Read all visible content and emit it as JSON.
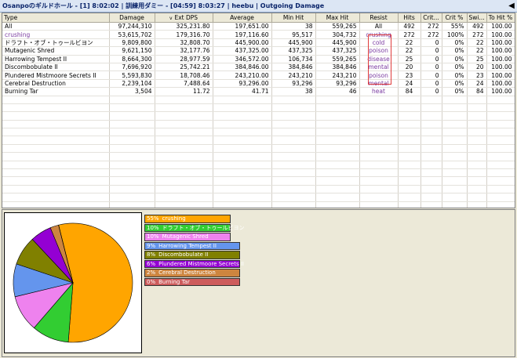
{
  "window": {
    "title": "Osanpoのギルドホール - [1] 8:02:02 | 訓練用ダミー - [04:59] 8:03:27 | heebu | Outgoing Damage",
    "nav_icon": "left-arrow-icon"
  },
  "table": {
    "sort_indicator": "v",
    "headers": [
      "Type",
      "Damage",
      "Ext DPS",
      "Average",
      "Min Hit",
      "Max Hit",
      "Resist",
      "Hits",
      "Crit...",
      "Crit %",
      "Swi...",
      "To Hit %"
    ],
    "rows": [
      [
        "All",
        "97,244,310",
        "325,231.80",
        "197,651.00",
        "38",
        "559,265",
        "All",
        "492",
        "272",
        "55%",
        "492",
        "100.00"
      ],
      [
        "crushing",
        "53,615,702",
        "179,316.70",
        "197,116.60",
        "95,517",
        "304,732",
        "crushing",
        "272",
        "272",
        "100%",
        "272",
        "100.00"
      ],
      [
        "ドラフト・オブ・トゥールビヨン",
        "9,809,800",
        "32,808.70",
        "445,900.00",
        "445,900",
        "445,900",
        "cold",
        "22",
        "0",
        "0%",
        "22",
        "100.00"
      ],
      [
        "Mutagenic Shred",
        "9,621,150",
        "32,177.76",
        "437,325.00",
        "437,325",
        "437,325",
        "poison",
        "22",
        "0",
        "0%",
        "22",
        "100.00"
      ],
      [
        "Harrowing Tempest II",
        "8,664,300",
        "28,977.59",
        "346,572.00",
        "106,734",
        "559,265",
        "disease",
        "25",
        "0",
        "0%",
        "25",
        "100.00"
      ],
      [
        "Discombobulate II",
        "7,696,920",
        "25,742.21",
        "384,846.00",
        "384,846",
        "384,846",
        "mental",
        "20",
        "0",
        "0%",
        "20",
        "100.00"
      ],
      [
        "Plundered Mistmoore Secrets II",
        "5,593,830",
        "18,708.46",
        "243,210.00",
        "243,210",
        "243,210",
        "poison",
        "23",
        "0",
        "0%",
        "23",
        "100.00"
      ],
      [
        "Cerebral Destruction",
        "2,239,104",
        "7,488.64",
        "93,296.00",
        "93,296",
        "93,296",
        "mental",
        "24",
        "0",
        "0%",
        "24",
        "100.00"
      ],
      [
        "Burning Tar",
        "3,504",
        "11.72",
        "41.71",
        "38",
        "46",
        "heat",
        "84",
        "0",
        "0%",
        "84",
        "100.00"
      ]
    ],
    "empty_rows": 15
  },
  "legend": [
    {
      "pct": "55%",
      "label": "crushing",
      "color": "#ffa500"
    },
    {
      "pct": "10%",
      "label": "ドラフト・オブ・トゥールビヨン",
      "color": "#32cd32"
    },
    {
      "pct": "10%",
      "label": "Mutagenic Shred",
      "color": "#ee82ee"
    },
    {
      "pct": "9%",
      "label": "Harrowing Tempest II",
      "color": "#6495ed"
    },
    {
      "pct": "8%",
      "label": "Discombobulate II",
      "color": "#808000"
    },
    {
      "pct": "6%",
      "label": "Plundered Mistmoore Secrets II",
      "color": "#9400d3"
    },
    {
      "pct": "2%",
      "label": "Cerebral Destruction",
      "color": "#cd853f"
    },
    {
      "pct": "0%",
      "label": "Burning Tar",
      "color": "#cd5c5c"
    }
  ],
  "chart_data": {
    "type": "pie",
    "categories": [
      "crushing",
      "ドラフト・オブ・トゥールビヨン",
      "Mutagenic Shred",
      "Harrowing Tempest II",
      "Discombobulate II",
      "Plundered Mistmoore Secrets II",
      "Cerebral Destruction",
      "Burning Tar"
    ],
    "values": [
      53615702,
      9809800,
      9621150,
      8664300,
      7696920,
      5593830,
      2239104,
      3504
    ],
    "colors": [
      "#ffa500",
      "#32cd32",
      "#ee82ee",
      "#6495ed",
      "#808000",
      "#9400d3",
      "#cd853f",
      "#cd5c5c"
    ]
  }
}
